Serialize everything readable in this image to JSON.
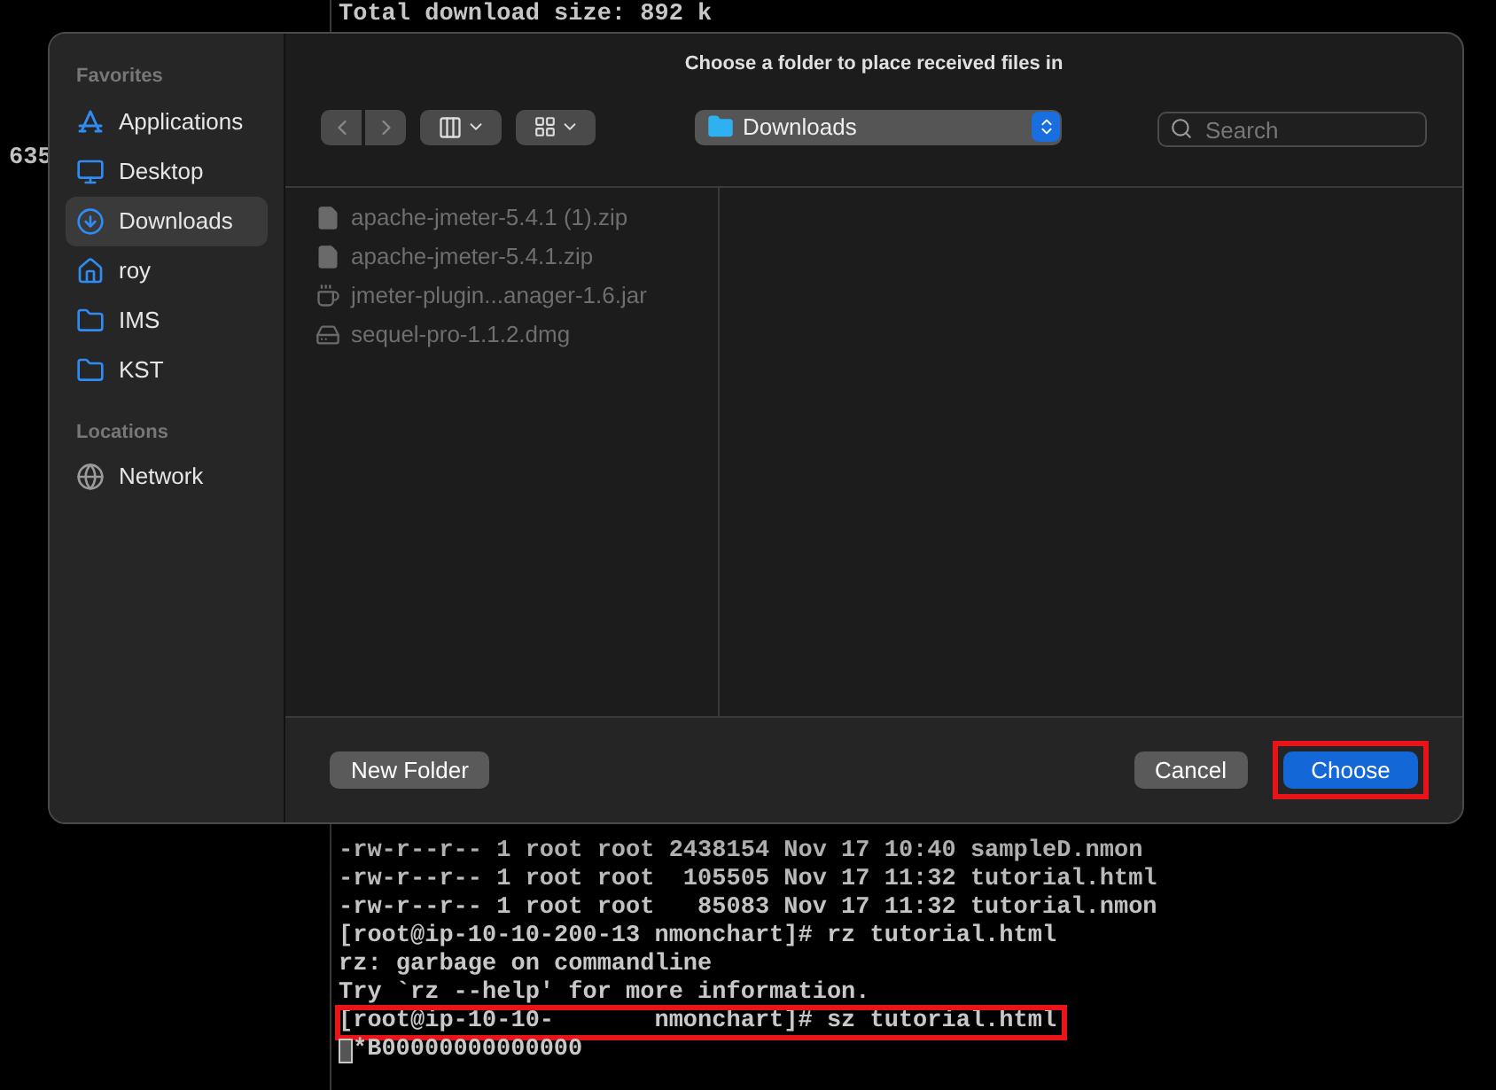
{
  "terminal": {
    "side_fragment": "635",
    "top_lines": [
      "Total download size: 892 k"
    ],
    "bottom_lines": [
      {
        "text": "-rw-r--r-- 1 root root 2438154 Nov 17 10:40 sampleD.nmon",
        "highlighted": false
      },
      {
        "text": "-rw-r--r-- 1 root root  105505 Nov 17 11:32 tutorial.html",
        "highlighted": false
      },
      {
        "text": "-rw-r--r-- 1 root root   85083 Nov 17 11:32 tutorial.nmon",
        "highlighted": false
      },
      {
        "text": "[root@ip-10-10-200-13 nmonchart]# rz tutorial.html",
        "highlighted": false
      },
      {
        "text": "rz: garbage on commandline",
        "highlighted": false
      },
      {
        "text": "Try `rz --help' for more information.",
        "highlighted": false
      },
      {
        "text": "[root@ip-10-10-       nmonchart]# sz tutorial.html",
        "highlighted": true
      }
    ],
    "cursor_line": "*B00000000000000"
  },
  "dialog": {
    "title": "Choose a folder to place received files in",
    "sidebar": [
      {
        "heading": "Favorites",
        "items": [
          {
            "label": "Applications",
            "kind": "applications",
            "selected": false
          },
          {
            "label": "Desktop",
            "kind": "desktop",
            "selected": false
          },
          {
            "label": "Downloads",
            "kind": "downloads",
            "selected": true
          },
          {
            "label": "roy",
            "kind": "home",
            "selected": false
          },
          {
            "label": "IMS",
            "kind": "folder",
            "selected": false
          },
          {
            "label": "KST",
            "kind": "folder",
            "selected": false
          }
        ]
      },
      {
        "heading": "Locations",
        "items": [
          {
            "label": "Network",
            "kind": "network",
            "selected": false
          }
        ]
      }
    ],
    "location": "Downloads",
    "search": {
      "placeholder": "Search"
    },
    "files": [
      {
        "name": "apache-jmeter-5.4.1 (1).zip",
        "kind": "document"
      },
      {
        "name": "apache-jmeter-5.4.1.zip",
        "kind": "document"
      },
      {
        "name": "jmeter-plugin...anager-1.6.jar",
        "kind": "java"
      },
      {
        "name": "sequel-pro-1.1.2.dmg",
        "kind": "disk-image"
      }
    ],
    "buttons": [
      {
        "label": "New Folder",
        "kind": "secondary",
        "highlighted": false
      },
      {
        "label": "Cancel",
        "kind": "secondary",
        "highlighted": false
      },
      {
        "label": "Choose",
        "kind": "primary",
        "highlighted": true
      }
    ]
  }
}
